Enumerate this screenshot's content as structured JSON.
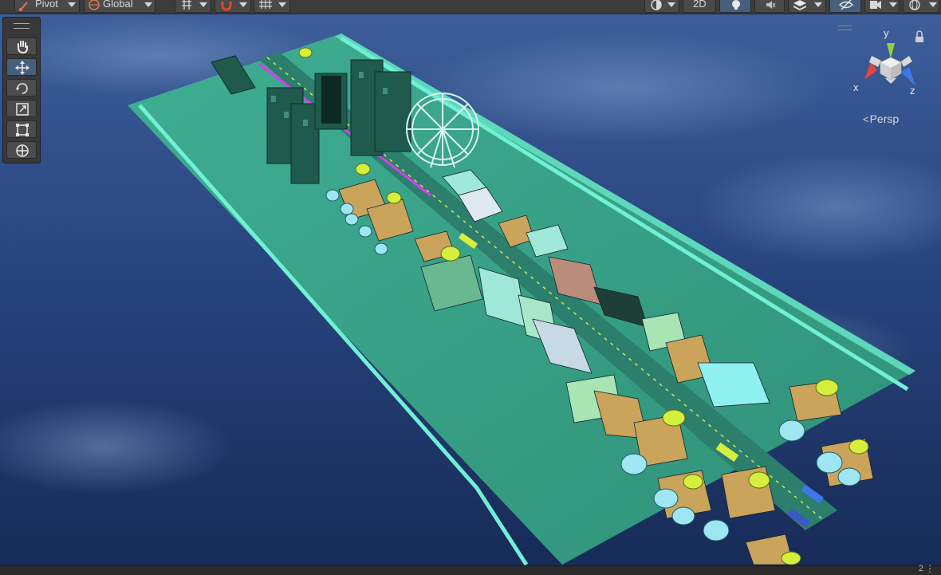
{
  "toolbar": {
    "pivot_label": "Pivot",
    "global_label": "Global",
    "mode_2d_label": "2D"
  },
  "tools": [
    {
      "name": "hand-tool-icon"
    },
    {
      "name": "move-tool-icon"
    },
    {
      "name": "rotate-tool-icon"
    },
    {
      "name": "scale-tool-icon"
    },
    {
      "name": "rect-tool-icon"
    },
    {
      "name": "transform-tool-icon"
    }
  ],
  "gizmo": {
    "y_label": "y",
    "x_label": "x",
    "z_label": "z",
    "projection_label": "Persp"
  },
  "status": {
    "counter": "2"
  },
  "colors": {
    "ground": "#3aa38a",
    "road_stripe": "#6ef2d6",
    "sky": "#24407a",
    "toolbar": "#3c3c3c",
    "active_tool": "#46607c",
    "axis_x": "#e8453c",
    "axis_y": "#8fd13c",
    "axis_z": "#3c78e8"
  }
}
